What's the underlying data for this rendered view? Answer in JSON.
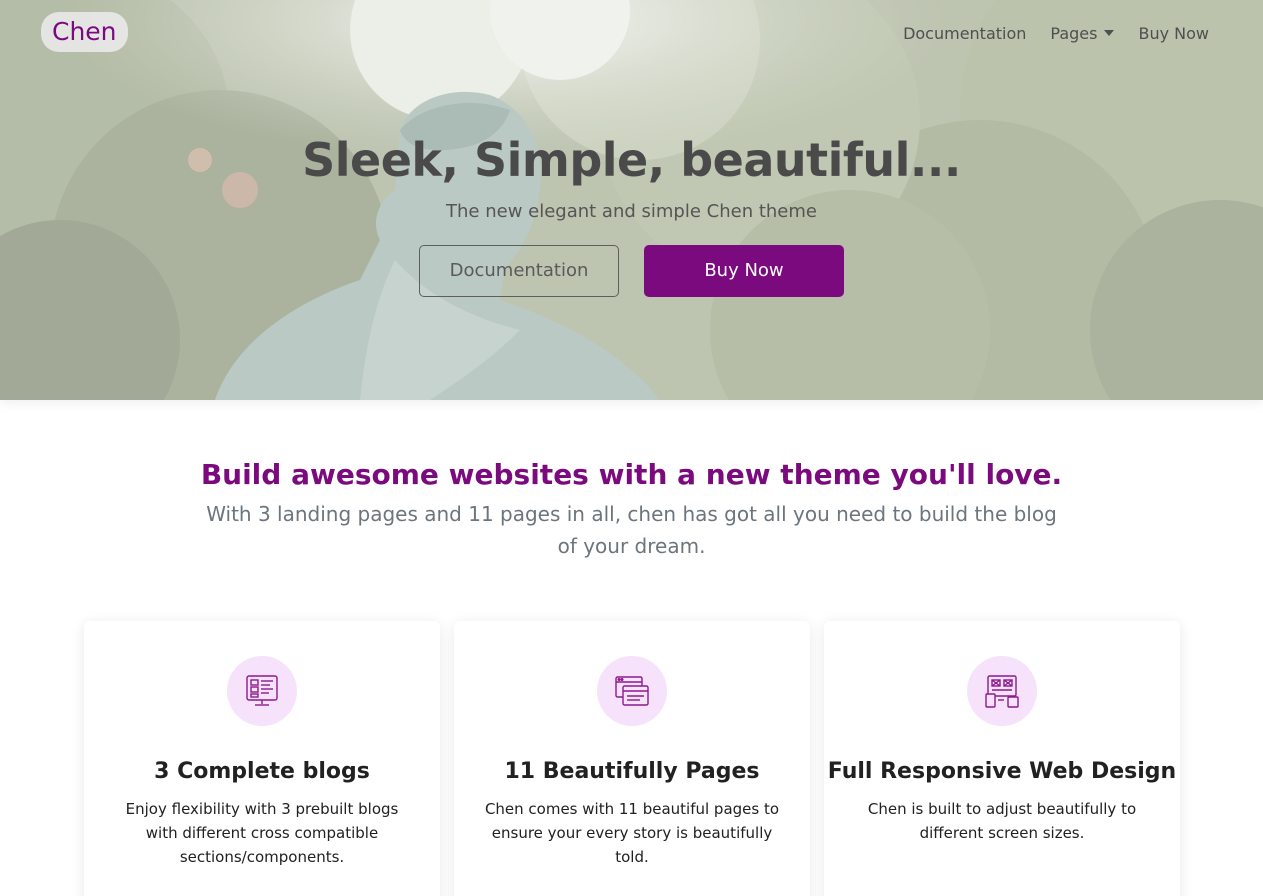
{
  "brand": {
    "name": "Chen"
  },
  "nav": {
    "documentation": "Documentation",
    "pages": "Pages",
    "buy_now": "Buy Now"
  },
  "hero": {
    "title": "Sleek, Simple, beautiful...",
    "subtitle": "The new elegant and simple Chen theme",
    "btn_documentation": "Documentation",
    "btn_buy_now": "Buy Now"
  },
  "intro": {
    "title": "Build awesome websites with a new theme you'll love.",
    "text": "With 3 landing pages and 11 pages in all, chen has got all you need to build the blog of your dream."
  },
  "features": [
    {
      "icon": "blog-layout-icon",
      "title": "3 Complete blogs",
      "text": "Enjoy flexibility with 3 prebuilt blogs with different cross compatible sections/components."
    },
    {
      "icon": "browser-pages-icon",
      "title": "11 Beautifully Pages",
      "text": "Chen comes with 11 beautiful pages to ensure your every story is beautifully told."
    },
    {
      "icon": "responsive-devices-icon",
      "title": "Full Responsive Web Design",
      "text": "Chen is built to adjust beautifully to different screen sizes."
    }
  ],
  "colors": {
    "accent": "#7b0a7e",
    "icon_circle": "#f6e2fa",
    "muted_text": "#6c757d"
  }
}
